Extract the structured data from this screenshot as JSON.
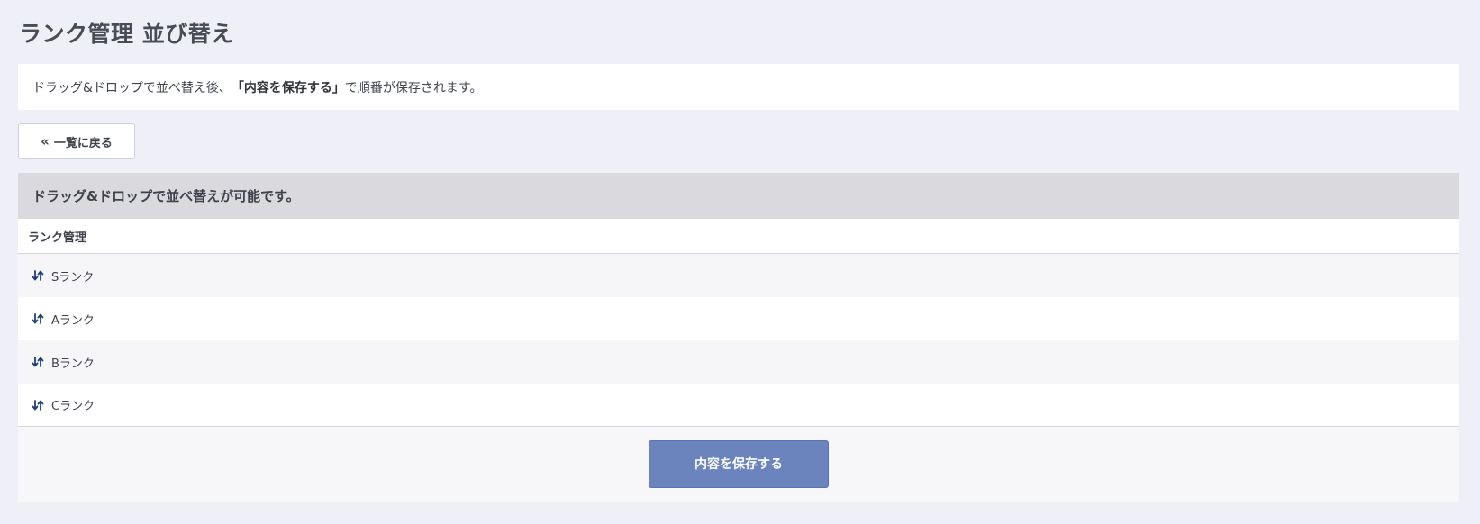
{
  "page": {
    "title": "ランク管理 並び替え"
  },
  "notice": {
    "prefix": "ドラッグ&ドロップで並べ替え後、",
    "emphasis": "「内容を保存する」",
    "suffix": "で順番が保存されます。"
  },
  "back_button": {
    "icon": "double-chevron-left-icon",
    "label": "一覧に戻る"
  },
  "panel": {
    "header": "ドラッグ&ドロップで並べ替えが可能です。",
    "column_header": "ランク管理",
    "rows": [
      {
        "label": "Sランク",
        "icon": "sort-arrows-icon"
      },
      {
        "label": "Aランク",
        "icon": "sort-arrows-icon"
      },
      {
        "label": "Bランク",
        "icon": "sort-arrows-icon"
      },
      {
        "label": "Cランク",
        "icon": "sort-arrows-icon"
      }
    ]
  },
  "save_button": {
    "label": "内容を保存する"
  },
  "colors": {
    "background": "#efeff7",
    "panel_header": "#d9d9de",
    "save_button": "#6b84bd",
    "sort_icon": "#1e3f7a"
  }
}
